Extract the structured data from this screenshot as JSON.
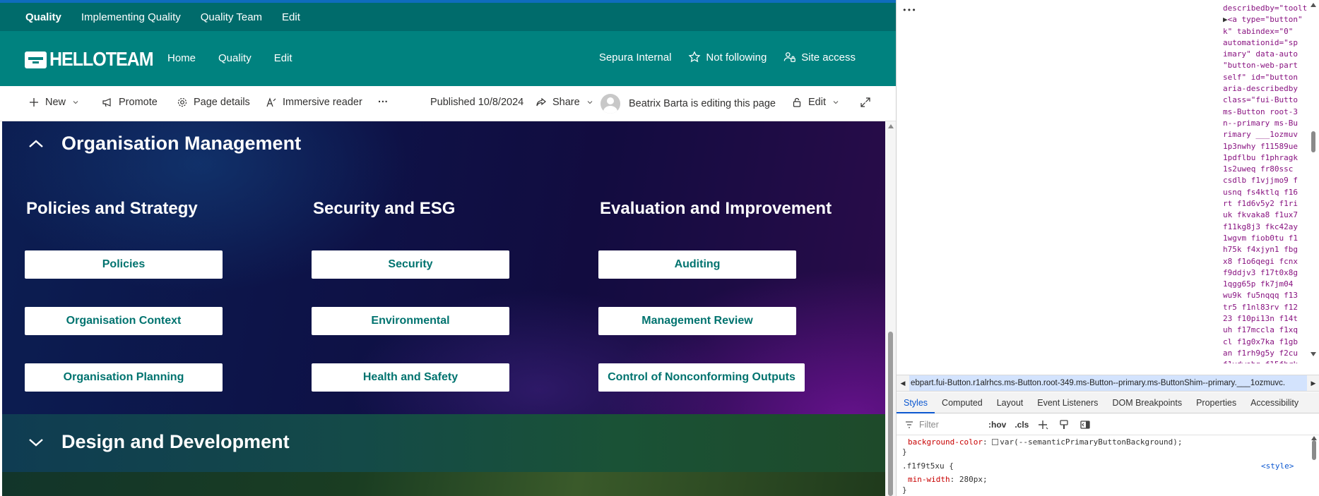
{
  "hub_nav": {
    "title": "Quality",
    "items": [
      "Implementing Quality",
      "Quality Team",
      "Edit"
    ]
  },
  "site_header": {
    "logo_text": "HELLOTEAM",
    "nav": [
      "Home",
      "Quality",
      "Edit"
    ],
    "sensitivity": "Sepura Internal",
    "follow_label": "Not following",
    "access_label": "Site access"
  },
  "command_bar": {
    "new_label": "New",
    "promote_label": "Promote",
    "page_details_label": "Page details",
    "immersive_reader_label": "Immersive reader",
    "more_label": "···",
    "published_label": "Published 10/8/2024",
    "share_label": "Share",
    "editing_label": "Beatrix Barta is editing this page",
    "edit_label": "Edit"
  },
  "sections": [
    {
      "title": "Organisation Management",
      "columns": [
        {
          "title": "Policies and Strategy",
          "buttons": [
            "Policies",
            "Organisation Context",
            "Organisation Planning"
          ]
        },
        {
          "title": "Security and ESG",
          "buttons": [
            "Security",
            "Environmental",
            "Health and Safety"
          ]
        },
        {
          "title": "Evaluation and Improvement",
          "buttons": [
            "Auditing",
            "Management Review",
            "Control of Nonconforming Outputs"
          ]
        }
      ]
    },
    {
      "title": "Design and Development"
    }
  ],
  "devtools": {
    "dots": "•••",
    "source_lines": [
      "describedby=\"toolt",
      "<a type=\"button\"",
      "k\" tabindex=\"0\"",
      "automationid=\"sp",
      "imary\" data-auto",
      "\"button-web-part",
      "self\" id=\"button",
      "aria-describedby",
      "class=\"fui-Butto",
      "ms-Button root-3",
      "n--primary ms-Bu",
      "rimary ___1ozmuv",
      "1p3nwhy f11589ue",
      "1pdflbu f1phragk",
      "1s2uweq fr80ssc",
      "csdlb f1vjjmo9 f",
      "usnq fs4ktlq f16",
      "rt f1d6v5y2 f1ri",
      "uk fkvaka8 f1ux7",
      "f11kg8j3 fkc42ay",
      "1wgvm fiob0tu f1",
      "h75k f4xjyn1 fbg",
      "x8 f1o6qegi fcnx",
      "f9ddjv3 f17t0x8g",
      "1qgg65p fk7jm04",
      "wu9k fu5nqqq f13",
      "tr5 f1nl83rv f12",
      "23 f10pi13n f14t",
      "uh f17mccla f1xq",
      "cl f1g0x7ka f1gb",
      "an f1rh9g5y f2cu",
      "f1vdwobg f15fhrk"
    ],
    "breadcrumb": "ebpart.fui-Button.r1alrhcs.ms-Button.root-349.ms-Button--primary.ms-ButtonShim--primary.___1ozmuvc.",
    "tabs": [
      "Styles",
      "Computed",
      "Layout",
      "Event Listeners",
      "DOM Breakpoints",
      "Properties",
      "Accessibility"
    ],
    "active_tab": "Styles",
    "filter_placeholder": "Filter",
    "hov_label": ":hov",
    "cls_label": ".cls",
    "styles": {
      "prop1_name": "background-color",
      "prop1_value": "var(--semanticPrimaryButtonBackground);",
      "close1": "}",
      "selector": ".f1f9t5xu {",
      "source_link": "<style>",
      "prop2_name": "min-width",
      "prop2_value": "280px;",
      "close2": "}"
    }
  }
}
